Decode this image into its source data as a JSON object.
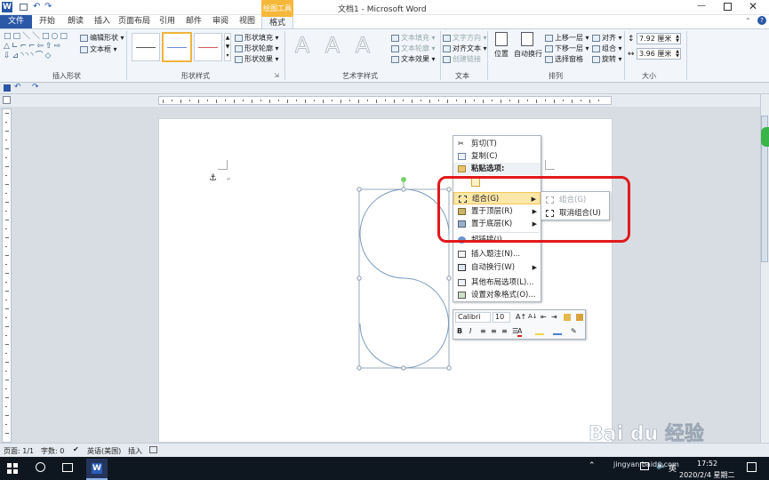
{
  "window": {
    "title": "文档1 - Microsoft Word",
    "app_icon": "W"
  },
  "tabs": [
    {
      "label": "文件"
    },
    {
      "label": "开始"
    },
    {
      "label": "朗读"
    },
    {
      "label": "插入"
    },
    {
      "label": "页面布局"
    },
    {
      "label": "引用"
    },
    {
      "label": "邮件"
    },
    {
      "label": "审阅"
    },
    {
      "label": "视图"
    },
    {
      "label": "格式"
    }
  ],
  "contextual_tab": "绘图工具",
  "ribbon": {
    "insert_shapes": {
      "label": "插入形状",
      "edit_shape": "编辑形状",
      "text_box": "文本框"
    },
    "shape_styles": {
      "label": "形状样式",
      "fill": "形状填充",
      "outline": "形状轮廓",
      "effects": "形状效果"
    },
    "wordart": {
      "label": "艺术字样式",
      "glyph": "A",
      "text_fill": "文本填充",
      "text_outline": "文本轮廓",
      "text_effects": "文本效果"
    },
    "text": {
      "label": "文本",
      "direction": "文字方向",
      "align": "对齐文本",
      "link": "创建链接"
    },
    "arrange": {
      "label": "排列",
      "position": "位置",
      "wrap": "自动换行",
      "forward": "上移一层",
      "backward": "下移一层",
      "pane": "选择窗格",
      "align": "对齐",
      "group": "组合",
      "rotate": "旋转"
    },
    "size": {
      "label": "大小",
      "height": "7.92 厘米",
      "width": "3.96 厘米"
    }
  },
  "context_menu": {
    "items": [
      {
        "label": "剪切(T)",
        "icon": "scissors-icon"
      },
      {
        "label": "复制(C)",
        "icon": "copy-icon"
      },
      {
        "label": "粘贴选项:",
        "icon": "paste-icon"
      },
      {
        "label": "组合(G)",
        "icon": "group-icon"
      },
      {
        "label": "置于顶层(R)",
        "icon": "bring-front-icon"
      },
      {
        "label": "置于底层(K)",
        "icon": "send-back-icon"
      },
      {
        "label": "超链接(I)...",
        "icon": "hyperlink-icon"
      },
      {
        "label": "插入题注(N)...",
        "icon": "caption-icon"
      },
      {
        "label": "自动换行(W)",
        "icon": "wrap-icon"
      },
      {
        "label": "其他布局选项(L)...",
        "icon": "layout-icon"
      },
      {
        "label": "设置对象格式(O)...",
        "icon": "format-icon"
      }
    ],
    "submenu": [
      {
        "label": "组合(G)"
      },
      {
        "label": "取消组合(U)"
      }
    ]
  },
  "mini_toolbar": {
    "font": "Calibri",
    "size": "10",
    "bold": "B",
    "italic": "I",
    "font_color": "A"
  },
  "status": {
    "page": "页面: 1/1",
    "words": "字数: 0",
    "lang": "英语(美国)",
    "insert": "插入"
  },
  "taskbar": {
    "time": "17:52",
    "date": "2020/2/4 星期二",
    "ime": "英"
  },
  "watermark": {
    "text": "Bai du 经验",
    "sub": "jingyan.baidu.com"
  },
  "colors": {
    "file_tab": "#2a57a6",
    "menu_highlight": "#fde7a8",
    "annotation": "#e0191b",
    "shape_outline": "#7c9cc0"
  }
}
